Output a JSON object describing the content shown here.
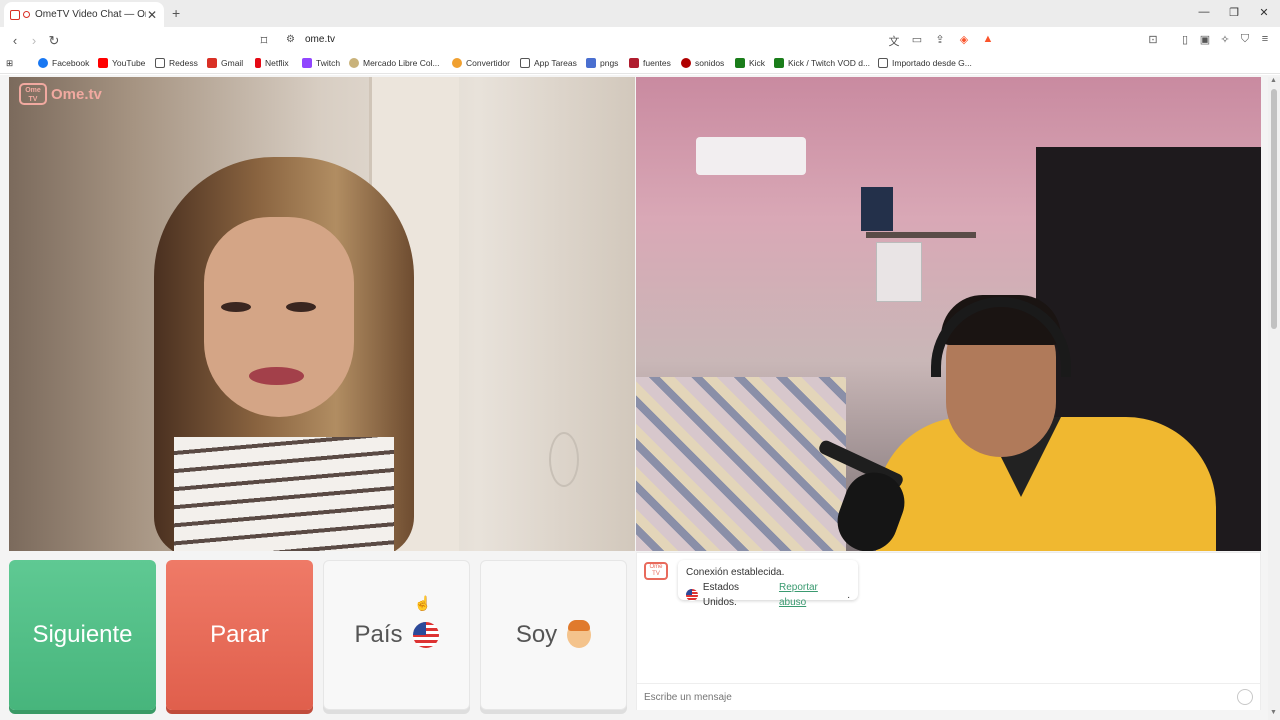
{
  "browser": {
    "tab_title": "OmeTV Video Chat — Omeg",
    "tab_close": "✕",
    "new_tab": "+",
    "url": "ome.tv",
    "window_controls": {
      "minimize": "—",
      "restore": "❐",
      "close": "✕"
    }
  },
  "bookmarks": [
    {
      "label": "Facebook",
      "icon": "facebook-icon",
      "color": "#1877f2"
    },
    {
      "label": "YouTube",
      "icon": "youtube-icon",
      "color": "#ff0000"
    },
    {
      "label": "Redess",
      "icon": "folder-icon",
      "color": "#555555"
    },
    {
      "label": "Gmail",
      "icon": "gmail-icon",
      "color": "#d93025"
    },
    {
      "label": "Netflix",
      "icon": "netflix-icon",
      "color": "#e50914"
    },
    {
      "label": "Twitch",
      "icon": "twitch-icon",
      "color": "#9146ff"
    },
    {
      "label": "Mercado Libre Col...",
      "icon": "mercadolibre-icon",
      "color": "#c9b27a"
    },
    {
      "label": "Convertidor",
      "icon": "convertidor-icon",
      "color": "#f0a030"
    },
    {
      "label": "App Tareas",
      "icon": "folder-icon",
      "color": "#555555"
    },
    {
      "label": "pngs",
      "icon": "pngs-icon",
      "color": "#4a6fd0"
    },
    {
      "label": "fuentes",
      "icon": "fuentes-icon",
      "color": "#b01c2e"
    },
    {
      "label": "sonidos",
      "icon": "sonidos-icon",
      "color": "#b00000"
    },
    {
      "label": "Kick",
      "icon": "kick-icon",
      "color": "#1a7d1a"
    },
    {
      "label": "Kick / Twitch VOD d...",
      "icon": "vod-icon",
      "color": "#1a7d1a"
    },
    {
      "label": "Importado desde G...",
      "icon": "folder-icon",
      "color": "#555555"
    }
  ],
  "brand": {
    "logo_text": "Ome.tv",
    "logo_badge": "Ome TV",
    "accent": "#e86a5c"
  },
  "controls": {
    "next_label": "Siguiente",
    "stop_label": "Parar",
    "country_label": "País",
    "gender_label": "Soy",
    "next_color": "#5fc993",
    "stop_color": "#ef7a67"
  },
  "chat": {
    "status": "Conexión establecida.",
    "country": "Estados Unidos.",
    "report_link": "Reportar abuso",
    "report_suffix": ".",
    "placeholder": "Escribe un mensaje"
  }
}
